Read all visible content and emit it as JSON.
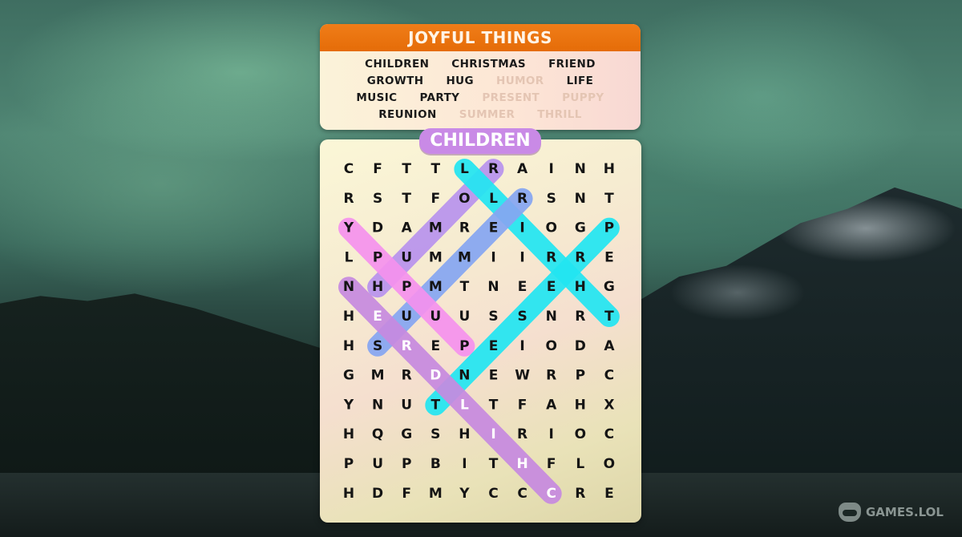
{
  "puzzle": {
    "title": "JOYFUL THINGS",
    "words": [
      [
        {
          "text": "CHILDREN",
          "found": false
        },
        {
          "text": "CHRISTMAS",
          "found": false
        },
        {
          "text": "FRIEND",
          "found": false
        }
      ],
      [
        {
          "text": "GROWTH",
          "found": false
        },
        {
          "text": "HUG",
          "found": false
        },
        {
          "text": "HUMOR",
          "found": true
        },
        {
          "text": "LIFE",
          "found": false
        }
      ],
      [
        {
          "text": "MUSIC",
          "found": false
        },
        {
          "text": "PARTY",
          "found": false
        },
        {
          "text": "PRESENT",
          "found": true
        },
        {
          "text": "PUPPY",
          "found": true
        }
      ],
      [
        {
          "text": "REUNION",
          "found": false
        },
        {
          "text": "SUMMER",
          "found": true
        },
        {
          "text": "THRILL",
          "found": true
        }
      ]
    ],
    "current_word": "CHILDREN",
    "current_word_color": "#c98ae6",
    "grid": [
      [
        "C",
        "F",
        "T",
        "T",
        "L",
        "R",
        "A",
        "I",
        "N",
        "H"
      ],
      [
        "R",
        "S",
        "T",
        "F",
        "O",
        "L",
        "R",
        "S",
        "N",
        "T"
      ],
      [
        "Y",
        "D",
        "A",
        "M",
        "R",
        "E",
        "I",
        "O",
        "G",
        "P"
      ],
      [
        "L",
        "P",
        "U",
        "M",
        "M",
        "I",
        "I",
        "R",
        "R",
        "E"
      ],
      [
        "N",
        "H",
        "P",
        "M",
        "T",
        "N",
        "E",
        "E",
        "H",
        "G"
      ],
      [
        "H",
        "E",
        "U",
        "U",
        "U",
        "S",
        "S",
        "N",
        "R",
        "T"
      ],
      [
        "H",
        "S",
        "R",
        "E",
        "P",
        "E",
        "I",
        "O",
        "D",
        "A"
      ],
      [
        "G",
        "M",
        "R",
        "D",
        "N",
        "E",
        "W",
        "R",
        "P",
        "C"
      ],
      [
        "Y",
        "N",
        "U",
        "T",
        "L",
        "T",
        "F",
        "A",
        "H",
        "X"
      ],
      [
        "H",
        "Q",
        "G",
        "S",
        "H",
        "I",
        "R",
        "I",
        "O",
        "C"
      ],
      [
        "P",
        "U",
        "P",
        "B",
        "I",
        "T",
        "H",
        "F",
        "L",
        "O"
      ],
      [
        "H",
        "D",
        "F",
        "M",
        "Y",
        "C",
        "C",
        "C",
        "R",
        "E"
      ]
    ],
    "highlights": [
      {
        "word": "HUMOR",
        "from": [
          0,
          5
        ],
        "to": [
          4,
          1
        ],
        "color": "#b993ee"
      },
      {
        "word": "THRILL",
        "from": [
          0,
          4
        ],
        "to": [
          5,
          9
        ],
        "color": "#22e6f2"
      },
      {
        "word": "SUMMER",
        "from": [
          1,
          6
        ],
        "to": [
          6,
          1
        ],
        "color": "#86a6f2"
      },
      {
        "word": "PUPPY",
        "from": [
          2,
          0
        ],
        "to": [
          6,
          4
        ],
        "color": "#f592ee"
      },
      {
        "word": "PRESENT",
        "from": [
          2,
          9
        ],
        "to": [
          8,
          3
        ],
        "color": "#22e6f2"
      },
      {
        "word": "CHILDREN",
        "from": [
          4,
          0
        ],
        "to": [
          11,
          7
        ],
        "color": "#c78ae0",
        "active": true
      }
    ],
    "selected_cells": [
      [
        5,
        1
      ],
      [
        6,
        2
      ],
      [
        7,
        3
      ],
      [
        8,
        4
      ],
      [
        9,
        5
      ],
      [
        10,
        6
      ],
      [
        11,
        7
      ]
    ]
  },
  "brand": {
    "label": "GAMES.LOL",
    "icon": "gamepad-icon"
  }
}
